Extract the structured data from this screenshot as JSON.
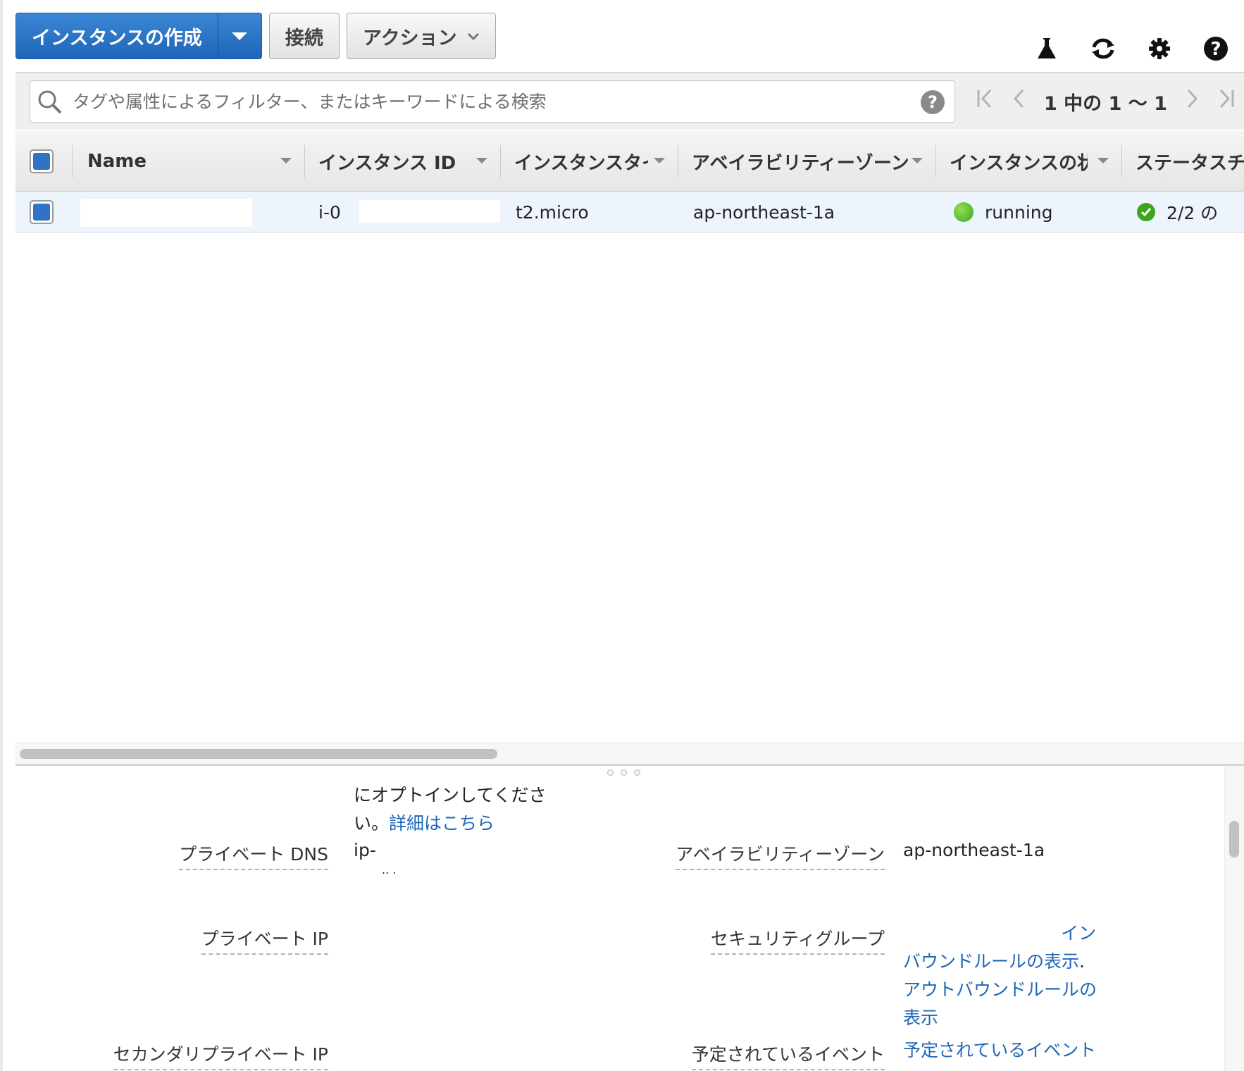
{
  "toolbar": {
    "launch_label": "インスタンスの作成",
    "connect_label": "接続",
    "actions_label": "アクション"
  },
  "top_icons": [
    "flask-icon",
    "refresh-icon",
    "gear-icon",
    "help-icon"
  ],
  "search": {
    "placeholder": "タグや属性によるフィルター、またはキーワードによる検索",
    "help": "?"
  },
  "pager": {
    "text": "1 中の 1 〜 1"
  },
  "table": {
    "columns": [
      "Name",
      "インスタンス ID",
      "インスタンスタイプ",
      "アベイラビリティーゾーン",
      "インスタンスの状態",
      "ステータスチェック"
    ],
    "rows": [
      {
        "name": "",
        "instance_id": "i-0",
        "instance_type": "t2.micro",
        "az": "ap-northeast-1a",
        "state": "running",
        "status": "2/2 の"
      }
    ]
  },
  "details": {
    "optin_line1": "にオプトインしてくださ",
    "optin_line2": "い。",
    "learn_more": "詳細はこちら",
    "private_dns_label": "プライベート DNS",
    "private_dns_value": "ip-",
    "private_dns_value2": "..      .",
    "az_label": "アベイラビリティーゾーン",
    "az_value": "ap-northeast-1a",
    "private_ip_label": "プライベート IP",
    "sg_label": "セキュリティグループ",
    "sg_link1": "イン",
    "sg_link2": "バウンドルールの表示",
    "sg_link2_suffix": ".",
    "sg_link3": "アウトバウンドルールの",
    "sg_link4": "表示",
    "secondary_ip_label": "セカンダリプライベート IP",
    "events_label": "予定されているイベント",
    "events_link": "予定されているイベント"
  },
  "colors": {
    "primary": "#1f66b8",
    "running": "#3fa61c",
    "row_selected": "#eef4fb"
  }
}
